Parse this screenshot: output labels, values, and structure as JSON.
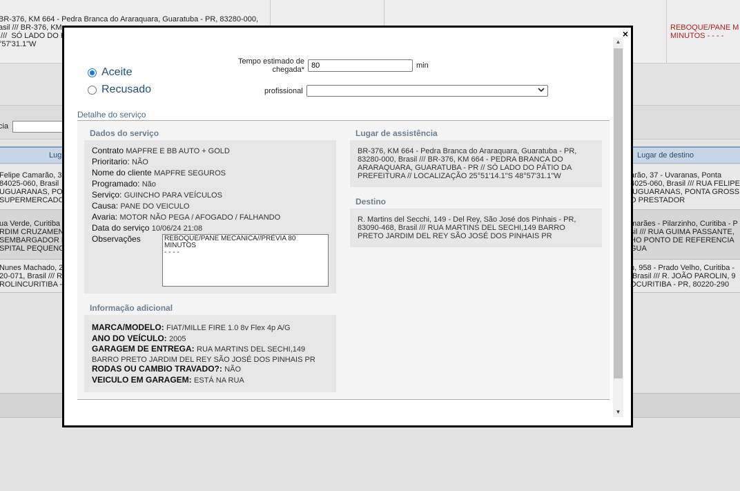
{
  "background": {
    "top_address": "BR-376, KM 664 - Pedra Branca do Araraquara, Guaratuba - PR, 83280-000,\nasil /// BR-376, KM\n ///  SÓ LADO DO P\n°57'31.1\"W",
    "top_right_red": "REBOQUE/PANE M\nMINUTOS - - - -",
    "filter_label": "cia",
    "col_left": "Lug",
    "col_right": "Lugar de destino",
    "rows": [
      {
        "left": "Felipe Camarão, 3\n84025-060, Brasil\nUGUARANAS, PO\nSUPERMERCADO",
        "right": "arão, 37 - Uvaranas, Ponta\n4025-060, Brasil /// RUA FELIPE\n UGUARANAS, PONTA GROSS\nO PRESTADOR"
      },
      {
        "left": "ua Verde, Curitiba\nRDIM CRUZAMENT\nSEMBARGADOR N\nSPITAL PEQUENO",
        "right": "marães - Pilarzinho, Curitiba - P\nsil /// RUA GUIMA PASSANTE,\nHO PONTO DE REFERENCIA\nGUA"
      },
      {
        "left": "Nunes Machado, 2\n20-071, Brasil /// R\nROLINCURITIBA -",
        "right": "n, 958 - Prado Velho, Curitiba -\n Brasil /// R. JOÃO PAROLIN, 9\nOCURITIBA - PR, 80220-290"
      }
    ]
  },
  "modal": {
    "close_label": "×",
    "radio_accept": "Aceite",
    "radio_refuse": "Recusado",
    "tempo_label": "Tempo estimado de chegada*",
    "tempo_value": "80",
    "min_label": "min",
    "profissional_label": "profissional",
    "profissional_value": "",
    "detail_legend": "Detalhe do serviço",
    "dados": {
      "title": "Dados do serviço",
      "fields": [
        {
          "k": "Contrato",
          "v": "MAPFRE E BB AUTO + GOLD"
        },
        {
          "k": "Prioritario:",
          "v": "NÃO"
        },
        {
          "k": "Nome do cliente",
          "v": "MAPFRE SEGUROS"
        },
        {
          "k": "Programado:",
          "v": "Não"
        },
        {
          "k": "Serviço:",
          "v": "GUINCHO PARA VEÍCULOS"
        },
        {
          "k": "Causa:",
          "v": "PANE DO VEICULO"
        },
        {
          "k": "Avaria:",
          "v": "MOTOR NÃO PEGA / AFOGADO / FALHANDO"
        },
        {
          "k": "Data do serviço",
          "v": "10/06/24 21:08"
        }
      ],
      "obs_label": "Observações",
      "obs_value": "REBOQUE/PANE MECANICA//PRÉVIA 80\nMINUTOS\n- - - -"
    },
    "lugar": {
      "title": "Lugar de assistência",
      "text": "BR-376, KM 664 - Pedra Branca do Araraquara, Guaratuba - PR, 83280-000, Brasil /// BR-376, KM 664 - PEDRA BRANCA DO ARARAQUARA, GUARATUBA - PR // SÓ LADO DO PÁTIO DA PREFEITURA // LOCALIZAÇÃO 25°51'14.1\"S 48°57'31.1\"W"
    },
    "destino": {
      "title": "Destino",
      "text": "R. Martins del Secchi, 149 - Del Rey, São José dos Pinhais - PR, 83090-468, Brasil /// RUA MARTINS DEL SECHI,149 BARRO PRETO JARDIM DEL REY SÃO JOSÉ DOS PINHAIS PR"
    },
    "info": {
      "title": "Informação adicional",
      "lines": [
        {
          "k": "MARCA/MODELO:",
          "v": "FIAT/MILLE FIRE 1.0 8v Flex 4p A/G"
        },
        {
          "k": "ANO DO VEÍCULO:",
          "v": "2005"
        },
        {
          "k": "GARAGEM DE ENTREGA:",
          "v": "RUA MARTINS DEL SECHI,149 BARRO PRETO JARDIM DEL REY SÃO JOSÉ DOS PINHAIS PR"
        },
        {
          "k": "RODAS OU CAMBIO TRAVADO?:",
          "v": "NÃO"
        },
        {
          "k": "VEICULO EM GARAGEM:",
          "v": "ESTÁ NA RUA"
        }
      ]
    }
  }
}
